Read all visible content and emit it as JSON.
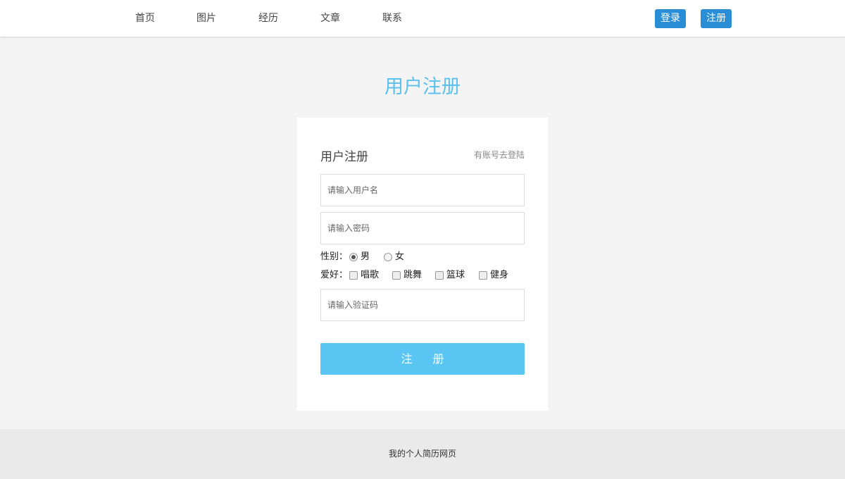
{
  "nav": {
    "items": [
      {
        "label": "首页"
      },
      {
        "label": "图片"
      },
      {
        "label": "经历"
      },
      {
        "label": "文章"
      },
      {
        "label": "联系"
      }
    ],
    "login_button": "登录",
    "register_button": "注册"
  },
  "page": {
    "title": "用户注册"
  },
  "form": {
    "title": "用户注册",
    "login_link": "有账号去登陆",
    "username_placeholder": "请输入用户名",
    "password_placeholder": "请输入密码",
    "gender_label": "性别：",
    "gender_options": [
      {
        "label": "男",
        "checked": true
      },
      {
        "label": "女",
        "checked": false
      }
    ],
    "hobby_label": "爱好：",
    "hobby_options": [
      {
        "label": "唱歌",
        "checked": false
      },
      {
        "label": "跳舞",
        "checked": false
      },
      {
        "label": "篮球",
        "checked": false
      },
      {
        "label": "健身",
        "checked": false
      }
    ],
    "captcha_placeholder": "请输入验证码",
    "submit_label": "注 册"
  },
  "footer": {
    "text": "我的个人简历网页"
  },
  "colors": {
    "accent": "#2a8ed6",
    "title": "#5bc0f0",
    "submit": "#5bc6f4",
    "background": "#f4f4f4"
  }
}
